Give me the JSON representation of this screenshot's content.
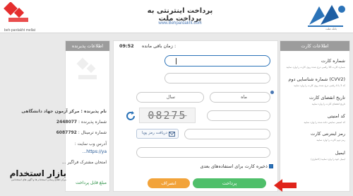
{
  "header": {
    "title": "پرداخت اینترنتی به پرداخت ملت",
    "url": "www.Behpardakht.com",
    "gateway_logo_text": "به‌پرداخت ملت",
    "gateway_logo_latin": "beh-pardakht mellat",
    "mellat_logo_text": "بانک ملت"
  },
  "merchant": {
    "header": "اطلاعات پذیرنده",
    "name_label": "نام پذیرنده :",
    "name_value": "مرکز آزمون جهاد دانشگاهی",
    "merchant_no_label": "شماره پذیرنده :",
    "merchant_no_value": "2448077",
    "terminal_label": "شماره ترمینال :",
    "terminal_value": "6087792",
    "website_label": "آدرس وب سایت :",
    "website_value": "https://ya...",
    "description": "امتحان مشترک فراگیر ...",
    "amount_label": "مبلغ قابل پرداخت"
  },
  "card": {
    "header": "اطلاعات کارت",
    "card_number_label": "شماره کارت",
    "card_number_hint": "شماره کارت 16 رقمی درج شده روی کارت را وارد نمایید",
    "cvv2_label": "شماره شناسایی دوم (CVV2)",
    "cvv2_hint": "کد 3 یا 4 رقمی درج شده روی کارت را وارد نمایید",
    "expiry_label": "تاریخ انقضای کارت",
    "expiry_hint": "تاریخ انقضای کارت را وارد نمایید",
    "captcha_label": "کد امنیتی",
    "captcha_hint": "کد امنیتی نمایش داده شده را وارد نمایید",
    "pin_label": "رمز اینترنتی کارت",
    "pin_hint": "رمز دوم کارت را وارد نمایید",
    "email_label": "ایمیل",
    "email_hint": "ایمیل خود را وارد نمایید (اختیاری)"
  },
  "main": {
    "timer_label": "زمان باقی مانده :",
    "timer_value": "09:52",
    "month_placeholder": "ماه",
    "year_placeholder": "سال",
    "captcha_text": "08275",
    "otp_button": "دریافت رمز پویا",
    "save_card_label": "ذخیره کارت برای استفاده‌های بعدی",
    "pay_button": "پرداخت",
    "cancel_button": "انصراف"
  },
  "watermark": {
    "site_name": "بازار استخدام",
    "site_sub": "مرکز اطلاع رسانی استخدام ها و آگهی های استخدامی"
  },
  "colors": {
    "pay_green": "#4fbf6a",
    "cancel_orange": "#f2a33a",
    "arrow_red": "#e0241b",
    "accent_blue": "#2b73b8"
  }
}
